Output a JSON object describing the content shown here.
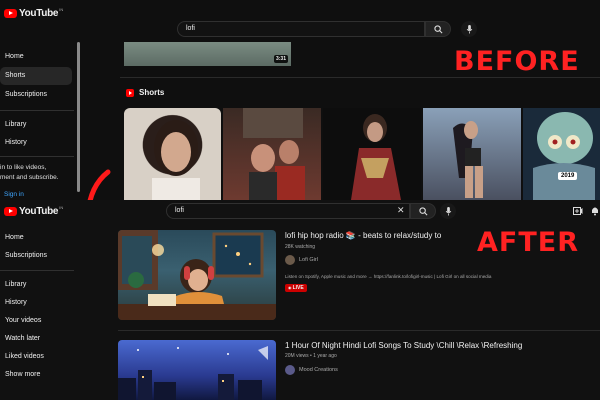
{
  "before": {
    "logo_text": "YouTube",
    "logo_cc": "IN",
    "search_value": "lofi",
    "video_duration": "3:31",
    "sidebar": [
      {
        "label": "Home"
      },
      {
        "label": "Shorts"
      },
      {
        "label": "Subscriptions"
      },
      {
        "label": "Library"
      },
      {
        "label": "History"
      }
    ],
    "signin_note": [
      "in to like videos,",
      "ment and subscribe."
    ],
    "signin_label": "Sign in",
    "shorts_heading": "Shorts",
    "banner": "BEFORE",
    "year_badge": "2019"
  },
  "after": {
    "logo_text": "YouTube",
    "logo_cc": "IN",
    "search_value": "lofi",
    "sidebar": [
      {
        "label": "Home"
      },
      {
        "label": "Subscriptions"
      },
      {
        "label": "Library"
      },
      {
        "label": "History"
      },
      {
        "label": "Your videos"
      },
      {
        "label": "Watch later"
      },
      {
        "label": "Liked videos"
      },
      {
        "label": "Show more"
      }
    ],
    "banner": "AFTER",
    "videos": [
      {
        "title": "lofi hip hop radio 📚 - beats to relax/study to",
        "meta": "28K watching",
        "channel": "Lofi Girl",
        "description": "Listen on Spotify, Apple music and more → https://fanlink.to/lofigirl-music | Lofi Girl on all social media",
        "badge": "LIVE"
      },
      {
        "title": "1 Hour Of Night Hindi Lofi Songs To Study \\Chill \\Relax \\Refreshing",
        "meta": "20M views • 1 year ago",
        "channel": "Mood Creations"
      }
    ]
  },
  "colors": {
    "background": "#0f0f0f",
    "banner_red": "#ff2222",
    "youtube_red": "#ff0000",
    "link_blue": "#3ea6ff",
    "live_red": "#cc0000"
  }
}
